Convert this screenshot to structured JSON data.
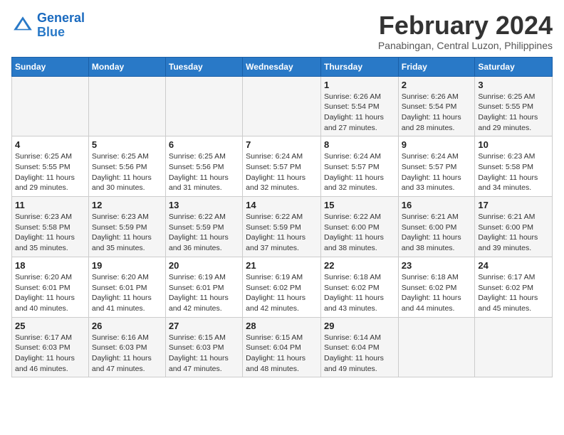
{
  "logo": {
    "line1": "General",
    "line2": "Blue"
  },
  "title": "February 2024",
  "subtitle": "Panabingan, Central Luzon, Philippines",
  "weekdays": [
    "Sunday",
    "Monday",
    "Tuesday",
    "Wednesday",
    "Thursday",
    "Friday",
    "Saturday"
  ],
  "weeks": [
    [
      {
        "day": "",
        "info": ""
      },
      {
        "day": "",
        "info": ""
      },
      {
        "day": "",
        "info": ""
      },
      {
        "day": "",
        "info": ""
      },
      {
        "day": "1",
        "info": "Sunrise: 6:26 AM\nSunset: 5:54 PM\nDaylight: 11 hours and 27 minutes."
      },
      {
        "day": "2",
        "info": "Sunrise: 6:26 AM\nSunset: 5:54 PM\nDaylight: 11 hours and 28 minutes."
      },
      {
        "day": "3",
        "info": "Sunrise: 6:25 AM\nSunset: 5:55 PM\nDaylight: 11 hours and 29 minutes."
      }
    ],
    [
      {
        "day": "4",
        "info": "Sunrise: 6:25 AM\nSunset: 5:55 PM\nDaylight: 11 hours and 29 minutes."
      },
      {
        "day": "5",
        "info": "Sunrise: 6:25 AM\nSunset: 5:56 PM\nDaylight: 11 hours and 30 minutes."
      },
      {
        "day": "6",
        "info": "Sunrise: 6:25 AM\nSunset: 5:56 PM\nDaylight: 11 hours and 31 minutes."
      },
      {
        "day": "7",
        "info": "Sunrise: 6:24 AM\nSunset: 5:57 PM\nDaylight: 11 hours and 32 minutes."
      },
      {
        "day": "8",
        "info": "Sunrise: 6:24 AM\nSunset: 5:57 PM\nDaylight: 11 hours and 32 minutes."
      },
      {
        "day": "9",
        "info": "Sunrise: 6:24 AM\nSunset: 5:57 PM\nDaylight: 11 hours and 33 minutes."
      },
      {
        "day": "10",
        "info": "Sunrise: 6:23 AM\nSunset: 5:58 PM\nDaylight: 11 hours and 34 minutes."
      }
    ],
    [
      {
        "day": "11",
        "info": "Sunrise: 6:23 AM\nSunset: 5:58 PM\nDaylight: 11 hours and 35 minutes."
      },
      {
        "day": "12",
        "info": "Sunrise: 6:23 AM\nSunset: 5:59 PM\nDaylight: 11 hours and 35 minutes."
      },
      {
        "day": "13",
        "info": "Sunrise: 6:22 AM\nSunset: 5:59 PM\nDaylight: 11 hours and 36 minutes."
      },
      {
        "day": "14",
        "info": "Sunrise: 6:22 AM\nSunset: 5:59 PM\nDaylight: 11 hours and 37 minutes."
      },
      {
        "day": "15",
        "info": "Sunrise: 6:22 AM\nSunset: 6:00 PM\nDaylight: 11 hours and 38 minutes."
      },
      {
        "day": "16",
        "info": "Sunrise: 6:21 AM\nSunset: 6:00 PM\nDaylight: 11 hours and 38 minutes."
      },
      {
        "day": "17",
        "info": "Sunrise: 6:21 AM\nSunset: 6:00 PM\nDaylight: 11 hours and 39 minutes."
      }
    ],
    [
      {
        "day": "18",
        "info": "Sunrise: 6:20 AM\nSunset: 6:01 PM\nDaylight: 11 hours and 40 minutes."
      },
      {
        "day": "19",
        "info": "Sunrise: 6:20 AM\nSunset: 6:01 PM\nDaylight: 11 hours and 41 minutes."
      },
      {
        "day": "20",
        "info": "Sunrise: 6:19 AM\nSunset: 6:01 PM\nDaylight: 11 hours and 42 minutes."
      },
      {
        "day": "21",
        "info": "Sunrise: 6:19 AM\nSunset: 6:02 PM\nDaylight: 11 hours and 42 minutes."
      },
      {
        "day": "22",
        "info": "Sunrise: 6:18 AM\nSunset: 6:02 PM\nDaylight: 11 hours and 43 minutes."
      },
      {
        "day": "23",
        "info": "Sunrise: 6:18 AM\nSunset: 6:02 PM\nDaylight: 11 hours and 44 minutes."
      },
      {
        "day": "24",
        "info": "Sunrise: 6:17 AM\nSunset: 6:02 PM\nDaylight: 11 hours and 45 minutes."
      }
    ],
    [
      {
        "day": "25",
        "info": "Sunrise: 6:17 AM\nSunset: 6:03 PM\nDaylight: 11 hours and 46 minutes."
      },
      {
        "day": "26",
        "info": "Sunrise: 6:16 AM\nSunset: 6:03 PM\nDaylight: 11 hours and 47 minutes."
      },
      {
        "day": "27",
        "info": "Sunrise: 6:15 AM\nSunset: 6:03 PM\nDaylight: 11 hours and 47 minutes."
      },
      {
        "day": "28",
        "info": "Sunrise: 6:15 AM\nSunset: 6:04 PM\nDaylight: 11 hours and 48 minutes."
      },
      {
        "day": "29",
        "info": "Sunrise: 6:14 AM\nSunset: 6:04 PM\nDaylight: 11 hours and 49 minutes."
      },
      {
        "day": "",
        "info": ""
      },
      {
        "day": "",
        "info": ""
      }
    ]
  ]
}
